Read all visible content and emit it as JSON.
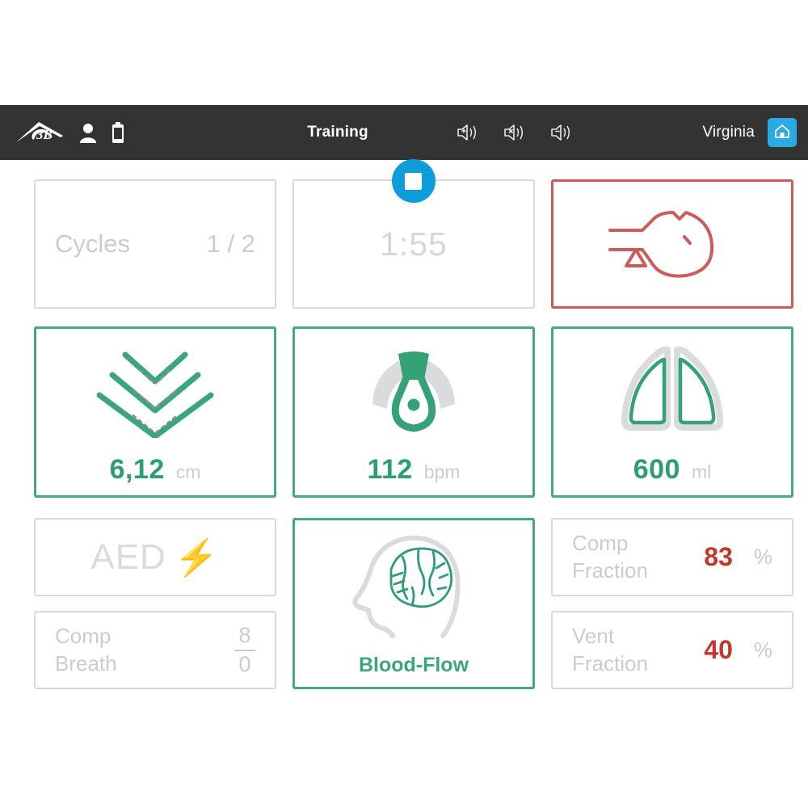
{
  "header": {
    "logo_name": "3B",
    "title": "Training",
    "user": "Virginia",
    "icons": {
      "user": "user-icon",
      "battery": "battery-icon",
      "volume_up": "volume-up-icon",
      "volume_mute": "volume-mute-icon",
      "volume_down": "volume-down-icon",
      "home": "home-icon"
    },
    "colors": {
      "bar_bg": "#333333",
      "home_bg": "#29abe2"
    }
  },
  "cards": {
    "cycles": {
      "label": "Cycles",
      "value": "1 / 2",
      "state": "inactive"
    },
    "timer": {
      "value": "1:55",
      "stop_button": "stop-button",
      "state": "inactive"
    },
    "airway": {
      "icon": "head-tilt-airway-icon",
      "state": "alert",
      "color": "#cf5a5a"
    },
    "depth": {
      "icon": "compression-depth-chevrons-icon",
      "value": "6,12",
      "unit": "cm",
      "state": "ok",
      "color": "#2d9d72"
    },
    "rate": {
      "icon": "metronome-rate-icon",
      "value": "112",
      "unit": "bpm",
      "state": "ok",
      "color": "#2d9d72"
    },
    "volume": {
      "icon": "lungs-icon",
      "value": "600",
      "unit": "ml",
      "state": "ok",
      "color": "#2d9d72"
    },
    "aed": {
      "label": "AED",
      "bolt": "⚡",
      "state": "inactive"
    },
    "comp_breath": {
      "label_line1": "Comp",
      "label_line2": "Breath",
      "numerator": "8",
      "denominator": "0",
      "state": "inactive"
    },
    "blood_flow": {
      "icon": "head-brain-icon",
      "caption": "Blood-Flow",
      "state": "ok",
      "color": "#3ba483"
    },
    "comp_fraction": {
      "label_line1": "Comp",
      "label_line2": "Fraction",
      "value": "83",
      "unit": "%",
      "color": "#c0392b"
    },
    "vent_fraction": {
      "label_line1": "Vent",
      "label_line2": "Fraction",
      "value": "40",
      "unit": "%",
      "color": "#c0392b"
    }
  }
}
